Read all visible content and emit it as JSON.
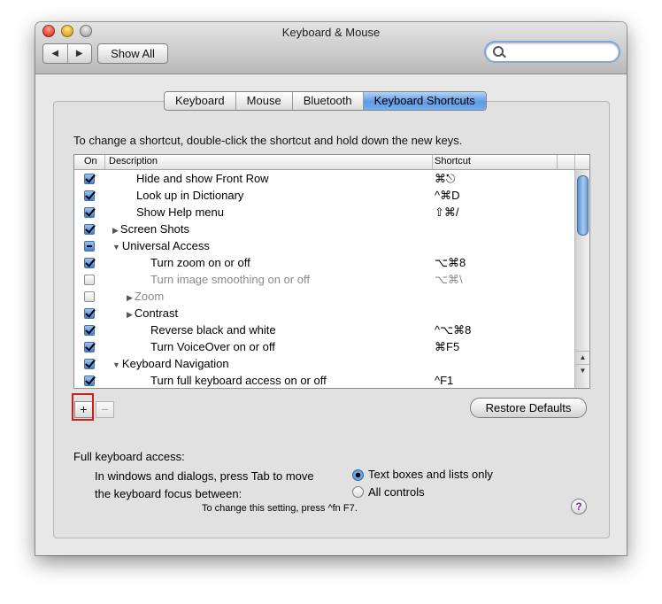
{
  "window": {
    "title": "Keyboard & Mouse"
  },
  "toolbar": {
    "back_glyph": "◀",
    "forward_glyph": "▶",
    "show_all_label": "Show All",
    "search_placeholder": ""
  },
  "tabs": [
    {
      "label": "Keyboard",
      "active": false
    },
    {
      "label": "Mouse",
      "active": false
    },
    {
      "label": "Bluetooth",
      "active": false
    },
    {
      "label": "Keyboard Shortcuts",
      "active": true
    }
  ],
  "instructions": "To change a shortcut, double-click the shortcut and hold down the new keys.",
  "table": {
    "columns": {
      "on": "On",
      "description": "Description",
      "shortcut": "Shortcut"
    },
    "rows": [
      {
        "state": "on",
        "indent": 1,
        "disclosure": "",
        "description": "Hide and show Front Row",
        "shortcut": "⌘⎋",
        "dim": false
      },
      {
        "state": "on",
        "indent": 1,
        "disclosure": "",
        "description": "Look up in Dictionary",
        "shortcut": "^⌘D",
        "dim": false
      },
      {
        "state": "on",
        "indent": 1,
        "disclosure": "",
        "description": "Show Help menu",
        "shortcut": "⇧⌘/",
        "dim": false
      },
      {
        "state": "on",
        "indent": 0,
        "disclosure": "▶",
        "description": "Screen Shots",
        "shortcut": "",
        "dim": false
      },
      {
        "state": "mixed",
        "indent": 0,
        "disclosure": "▼",
        "description": "Universal Access",
        "shortcut": "",
        "dim": false
      },
      {
        "state": "on",
        "indent": 2,
        "disclosure": "",
        "description": "Turn zoom on or off",
        "shortcut": "⌥⌘8",
        "dim": false
      },
      {
        "state": "off",
        "indent": 2,
        "disclosure": "",
        "description": "Turn image smoothing on or off",
        "shortcut": "⌥⌘\\",
        "dim": true
      },
      {
        "state": "off",
        "indent": 1,
        "disclosure": "▶",
        "description": "Zoom",
        "shortcut": "",
        "dim": true
      },
      {
        "state": "on",
        "indent": 1,
        "disclosure": "▶",
        "description": "Contrast",
        "shortcut": "",
        "dim": false
      },
      {
        "state": "on",
        "indent": 2,
        "disclosure": "",
        "description": "Reverse black and white",
        "shortcut": "^⌥⌘8",
        "dim": false
      },
      {
        "state": "on",
        "indent": 2,
        "disclosure": "",
        "description": "Turn VoiceOver on or off",
        "shortcut": "⌘F5",
        "dim": false
      },
      {
        "state": "on",
        "indent": 0,
        "disclosure": "▼",
        "description": "Keyboard Navigation",
        "shortcut": "",
        "dim": false
      },
      {
        "state": "on",
        "indent": 2,
        "disclosure": "",
        "description": "Turn full keyboard access on or off",
        "shortcut": "^F1",
        "dim": false
      }
    ]
  },
  "buttons": {
    "add_label": "+",
    "remove_label": "−",
    "restore_label": "Restore Defaults"
  },
  "full_keyboard_access": {
    "label": "Full keyboard access:",
    "line1": "In windows and dialogs, press Tab to move",
    "line2": "the keyboard focus between:",
    "options": [
      {
        "label": "Text boxes and lists only",
        "selected": true
      },
      {
        "label": "All controls",
        "selected": false
      }
    ],
    "hint": "To change this setting, press ^fn F7."
  },
  "help_label": "?",
  "colors": {
    "highlight": "#d21b1b",
    "accent": "#5e9ae4"
  }
}
